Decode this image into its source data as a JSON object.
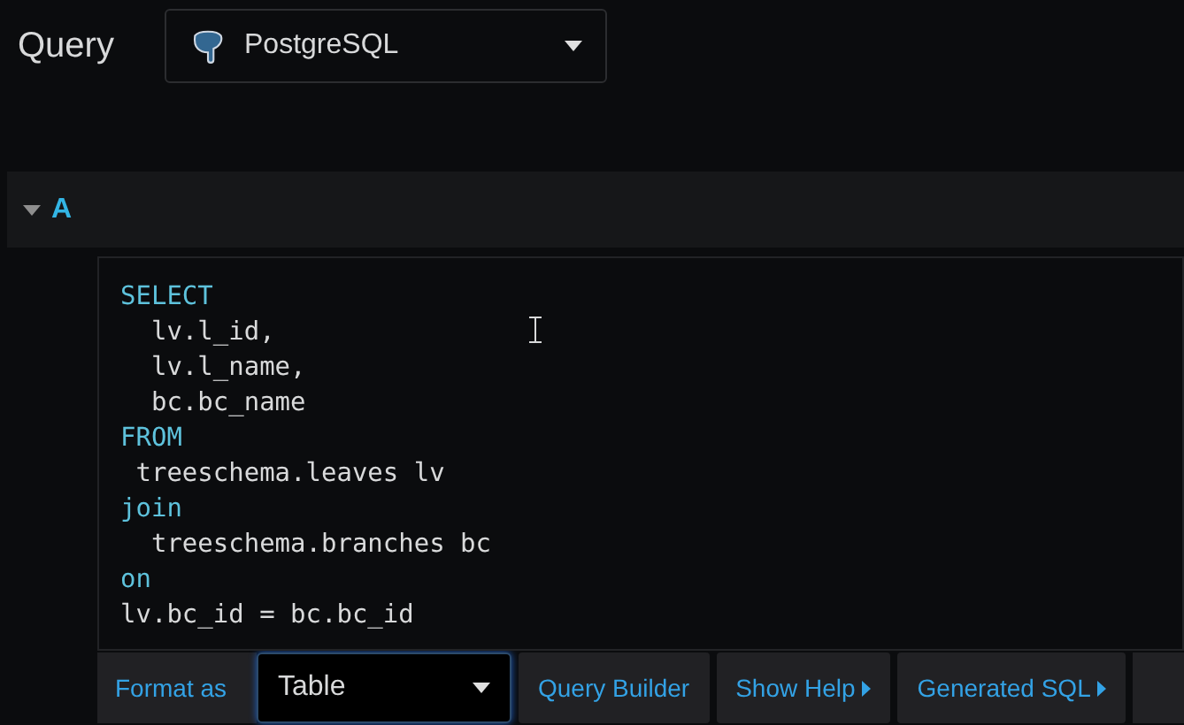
{
  "header": {
    "title": "Query",
    "datasource": "PostgreSQL"
  },
  "query": {
    "name": "A",
    "expanded": true,
    "lines": [
      {
        "kind": "keyword",
        "text": "SELECT"
      },
      {
        "kind": "code",
        "text": "  lv.l_id,"
      },
      {
        "kind": "code",
        "text": "  lv.l_name,"
      },
      {
        "kind": "code",
        "text": "  bc.bc_name"
      },
      {
        "kind": "keyword",
        "text": "FROM"
      },
      {
        "kind": "code",
        "text": " treeschema.leaves lv"
      },
      {
        "kind": "keyword",
        "text": "join"
      },
      {
        "kind": "code",
        "text": "  treeschema.branches bc"
      },
      {
        "kind": "keyword",
        "text": "on"
      },
      {
        "kind": "code",
        "text": "lv.bc_id = bc.bc_id"
      }
    ]
  },
  "toolbar": {
    "format_label": "Format as",
    "format_value": "Table",
    "buttons": [
      {
        "label": "Query Builder",
        "arrow": false
      },
      {
        "label": "Show Help",
        "arrow": true
      },
      {
        "label": "Generated SQL",
        "arrow": true
      }
    ]
  }
}
